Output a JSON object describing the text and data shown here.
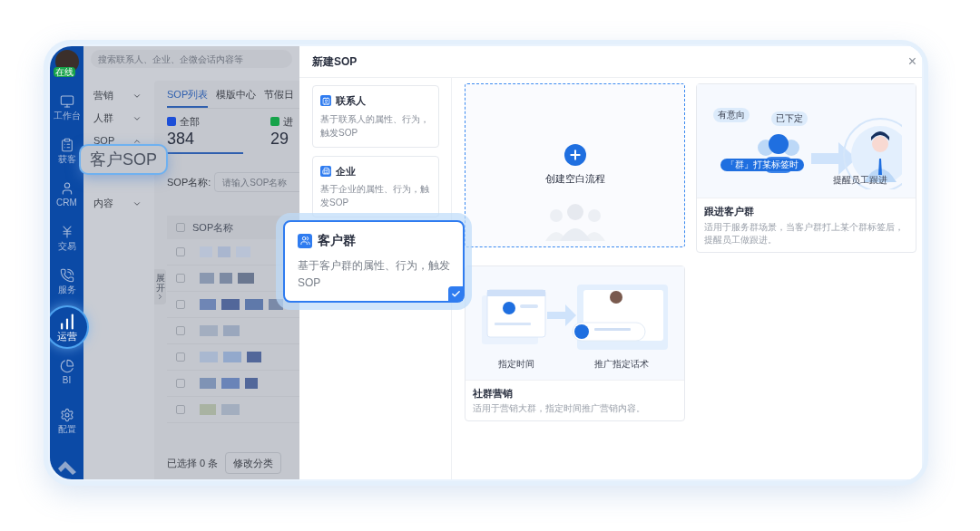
{
  "search": {
    "placeholder": "搜索联系人、企业、企微会话内容等"
  },
  "user": {
    "status": "在线"
  },
  "nav": [
    {
      "label": "工作台",
      "selected": false
    },
    {
      "label": "获客",
      "selected": false
    },
    {
      "label": "CRM",
      "selected": false
    },
    {
      "label": "交易",
      "selected": false
    },
    {
      "label": "服务",
      "selected": false
    },
    {
      "label": "运营",
      "selected": true
    },
    {
      "label": "BI",
      "selected": false
    },
    {
      "label": "配置",
      "selected": false
    }
  ],
  "menu": [
    {
      "label": "营销",
      "expanded": false
    },
    {
      "label": "人群",
      "expanded": false
    },
    {
      "label": "SOP",
      "expanded": true,
      "children": [
        {
          "label": "客户SOP",
          "selected": true
        }
      ]
    },
    {
      "label": "内容",
      "expanded": false
    }
  ],
  "tabs": [
    {
      "label": "SOP列表",
      "selected": true
    },
    {
      "label": "模版中心",
      "selected": false
    },
    {
      "label": "节假日",
      "selected": false
    }
  ],
  "stats": [
    {
      "label": "全部",
      "value": "384",
      "color": "#1d4fd8",
      "selected": true
    },
    {
      "label": "进",
      "value": "29",
      "color": "#16a34a",
      "selected": false
    }
  ],
  "filter": {
    "label": "SOP名称:",
    "placeholder": "请输入SOP名称"
  },
  "table": {
    "columns": [
      "SOP名称"
    ],
    "header_checked": false,
    "rows": [
      {
        "checked": false
      },
      {
        "checked": false
      },
      {
        "checked": false
      },
      {
        "checked": false
      },
      {
        "checked": false
      },
      {
        "checked": false
      },
      {
        "checked": false
      }
    ]
  },
  "expand_tab": "展开",
  "footer": {
    "selection": "已选择 0 条",
    "button": "修改分类"
  },
  "dialog": {
    "title": "新建SOP",
    "close": "×",
    "types": [
      {
        "title": "联系人",
        "description": "基于联系人的属性、行为，触发SOP",
        "selected": false
      },
      {
        "title": "企业",
        "description": "基于企业的属性、行为，触发SOP",
        "selected": false
      },
      {
        "title": "客户群",
        "description": "基于客户群的属性、行为，触发SOP",
        "selected": true
      }
    ],
    "templates": [
      {
        "kind": "blank",
        "title": "创建空白流程"
      },
      {
        "kind": "follow_up",
        "labels": [
          "有意向",
          "已下定",
          "「群」打某标签时",
          "提醒员工跟进"
        ],
        "title": "跟进客户群",
        "description": "适用于服务群场景，当客户群打上某个群标签后，提醒员工做跟进。"
      },
      {
        "kind": "marketing",
        "labels": [
          "指定时间",
          "推广指定话术"
        ],
        "title": "社群营销",
        "description": "适用于营销大群，指定时间推广营销内容。"
      }
    ]
  }
}
